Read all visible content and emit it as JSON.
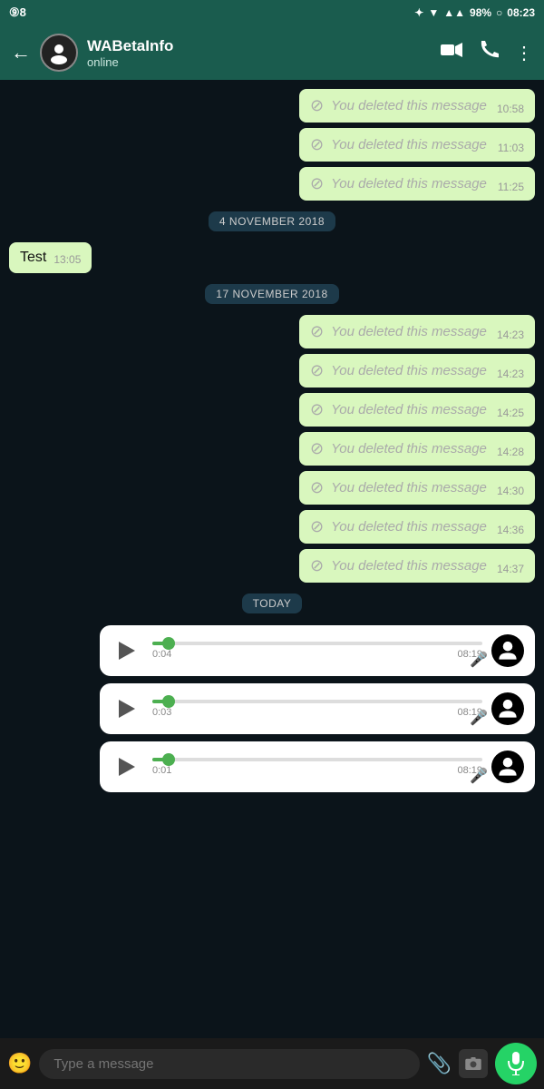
{
  "statusBar": {
    "leftIcon": "98",
    "battery": "98%",
    "time": "08:23"
  },
  "header": {
    "backLabel": "←",
    "contactName": "WABetaInfo",
    "contactStatus": "online",
    "avatarIcon": ""
  },
  "dateDividers": {
    "nov4": "4 NOVEMBER 2018",
    "nov17": "17 NOVEMBER 2018",
    "today": "TODAY"
  },
  "deletedMessages": [
    {
      "text": "You deleted this message",
      "time": "10:58"
    },
    {
      "text": "You deleted this message",
      "time": "11:03"
    },
    {
      "text": "You deleted this message",
      "time": "11:25"
    },
    {
      "text": "You deleted this message",
      "time": "14:23"
    },
    {
      "text": "You deleted this message",
      "time": "14:23"
    },
    {
      "text": "You deleted this message",
      "time": "14:25"
    },
    {
      "text": "You deleted this message",
      "time": "14:28"
    },
    {
      "text": "You deleted this message",
      "time": "14:30"
    },
    {
      "text": "You deleted this message",
      "time": "14:36"
    },
    {
      "text": "You deleted this message",
      "time": "14:37"
    }
  ],
  "testMessage": {
    "text": "Test",
    "time": "13:05"
  },
  "audioMessages": [
    {
      "duration": "0:04",
      "msgTime": "08:19"
    },
    {
      "duration": "0:03",
      "msgTime": "08:19"
    },
    {
      "duration": "0:01",
      "msgTime": "08:19"
    }
  ],
  "bottomBar": {
    "placeholder": "Type a message"
  }
}
